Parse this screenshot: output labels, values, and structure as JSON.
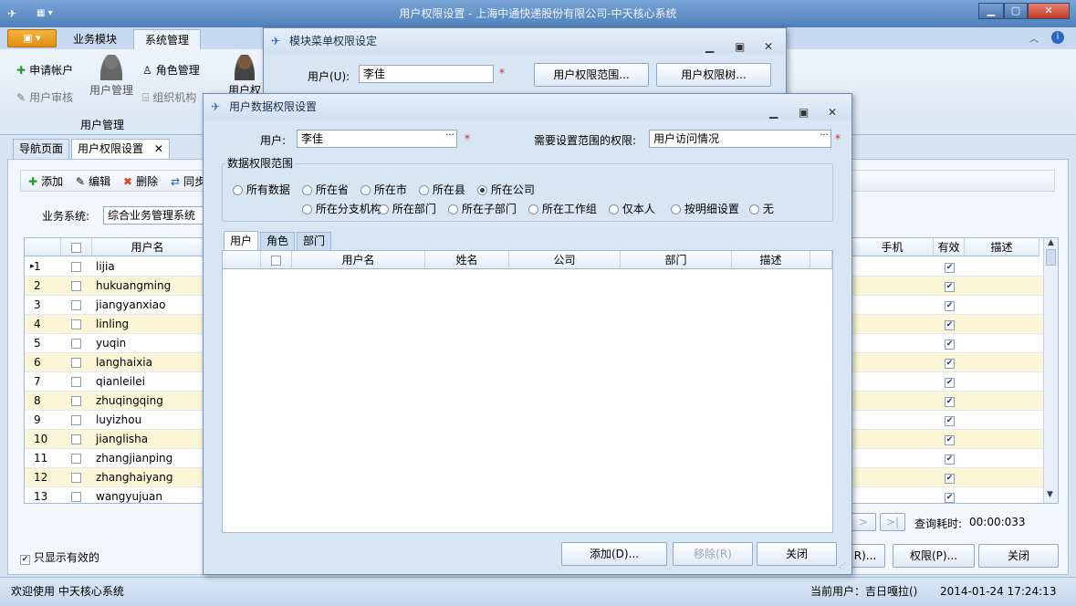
{
  "window": {
    "title": "用户权限设置 - 上海中通快递股份有限公司-中天核心系统"
  },
  "ribbon": {
    "tabs": [
      "业务模块",
      "系统管理"
    ],
    "buttons": {
      "apply_account": "申请帐户",
      "user_manage": "用户管理",
      "role_manage": "角色管理",
      "user_audit": "用户审核",
      "org": "组织机构",
      "user_perm_short": "用户权"
    },
    "group_label": "用户管理"
  },
  "doc_tabs": [
    "导航页面",
    "用户权限设置"
  ],
  "toolbar": {
    "add": "添加",
    "edit": "编辑",
    "delete": "删除",
    "sync": "同步"
  },
  "filter": {
    "label": "业务系统:",
    "value": "综合业务管理系统"
  },
  "grid": {
    "headers": {
      "username": "用户名",
      "phone": "手机",
      "valid": "有效",
      "desc": "描述"
    },
    "rows": [
      {
        "no": "1",
        "user": "lijia",
        "current": true
      },
      {
        "no": "2",
        "user": "hukuangming"
      },
      {
        "no": "3",
        "user": "jiangyanxiao"
      },
      {
        "no": "4",
        "user": "linling"
      },
      {
        "no": "5",
        "user": "yuqin"
      },
      {
        "no": "6",
        "user": "langhaixia"
      },
      {
        "no": "7",
        "user": "qianleilei"
      },
      {
        "no": "8",
        "user": "zhuqingqing"
      },
      {
        "no": "9",
        "user": "luyizhou"
      },
      {
        "no": "10",
        "user": "jianglisha"
      },
      {
        "no": "11",
        "user": "zhangjianping"
      },
      {
        "no": "12",
        "user": "zhanghaiyang"
      },
      {
        "no": "13",
        "user": "wangyujuan"
      }
    ]
  },
  "pager": {
    "next": ">",
    "last": ">|",
    "query_time_label": "查询耗时:",
    "query_time": "00:00:033"
  },
  "bottom": {
    "only_valid": "只显示有效的",
    "btn_r": "R)...",
    "perm_btn": "权限(P)...",
    "close_btn": "关闭"
  },
  "status": {
    "welcome": "欢迎使用 中天核心系统",
    "current_user": "当前用户：吉日嘎拉()",
    "datetime": "2014-01-24 17:24:13"
  },
  "module_dialog": {
    "title": "模块菜单权限设定",
    "user_label": "用户(U):",
    "user_value": "李佳",
    "scope_btn": "用户权限范围...",
    "tree_btn": "用户权限树..."
  },
  "data_dialog": {
    "title": "用户数据权限设置",
    "user_label": "用户:",
    "user_value": "李佳",
    "perm_label": "需要设置范围的权限:",
    "perm_value": "用户访问情况",
    "group_title": "数据权限范围",
    "radios_row1": [
      "所有数据",
      "所在省",
      "所在市",
      "所在县",
      "所在公司"
    ],
    "radios_row2": [
      "所在分支机构",
      "所在部门",
      "所在子部门",
      "所在工作组",
      "仅本人",
      "按明细设置",
      "无"
    ],
    "selected": "所在公司",
    "tabs": [
      "用户",
      "角色",
      "部门"
    ],
    "columns": [
      "用户名",
      "姓名",
      "公司",
      "部门",
      "描述"
    ],
    "add_btn": "添加(D)...",
    "remove_btn": "移除(R)",
    "close_btn": "关闭"
  }
}
